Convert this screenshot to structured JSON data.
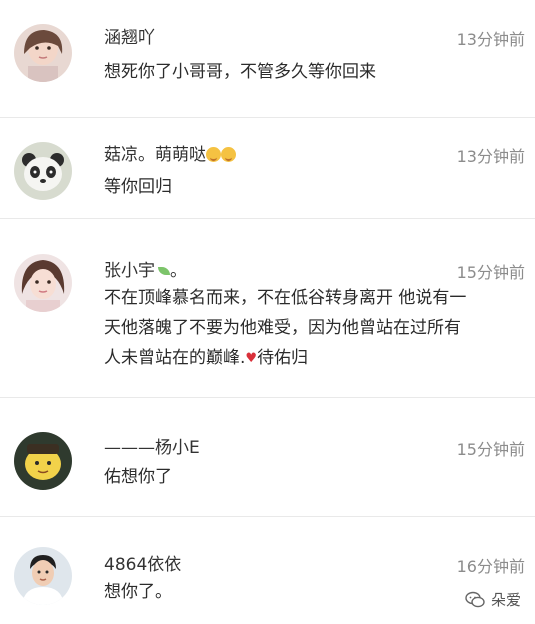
{
  "comments": [
    {
      "username": "涵翘吖",
      "time": "13分钟前",
      "text": "想死你了小哥哥，不管多久等你回来",
      "avatar_icon": "portrait-girl-avatar-icon"
    },
    {
      "username": "菇凉。萌萌哒",
      "username_emoji": "emoji-face-icon",
      "time": "13分钟前",
      "text": "等你回归",
      "avatar_icon": "panda-bear-avatar-icon"
    },
    {
      "username": "张小宇",
      "username_suffix": "。",
      "username_emoji": "leaf-icon",
      "time": "15分钟前",
      "text_lines": [
        "不在顶峰慕名而来，不在低谷转身离开 他说有一",
        "天他落魄了不要为他难受，因为他曾站在过所有",
        "人未曾站在的巅峰."
      ],
      "text_after_heart": "待佑归",
      "avatar_icon": "portrait-girl-avatar-icon"
    },
    {
      "username": "———杨小E",
      "time": "15分钟前",
      "text": "佑想你了",
      "avatar_icon": "cartoon-avatar-icon"
    },
    {
      "username": "4864依依",
      "time": "16分钟前",
      "text": "想你了。",
      "avatar_icon": "portrait-boy-avatar-icon"
    }
  ],
  "watermark": {
    "label": "朵爱",
    "icon": "wechat-icon"
  },
  "colors": {
    "username": "#333333",
    "time": "#8c8c8c",
    "divider": "#e9e9e9"
  }
}
